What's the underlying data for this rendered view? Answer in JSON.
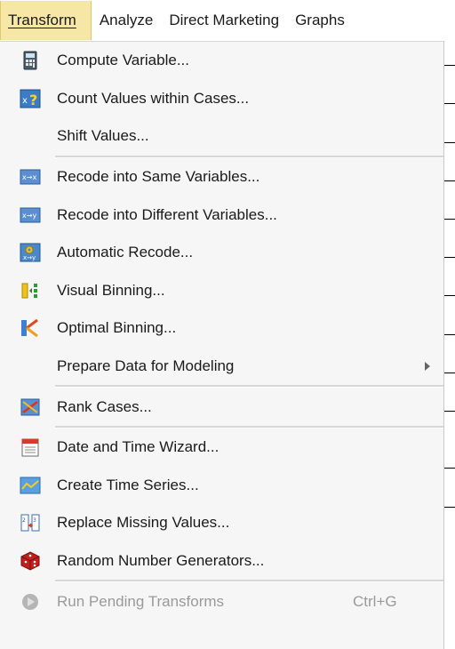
{
  "menubar": {
    "items": [
      {
        "label": "Transform",
        "active": true
      },
      {
        "label": "Analyze"
      },
      {
        "label": "Direct Marketing"
      },
      {
        "label": "Graphs"
      }
    ]
  },
  "menu": {
    "items": [
      {
        "label": "Compute Variable...",
        "icon": "calculator-icon"
      },
      {
        "label": "Count Values within Cases...",
        "icon": "count-x-question-icon"
      },
      {
        "label": "Shift Values...",
        "icon": null
      },
      {
        "label": "Recode into Same Variables...",
        "icon": "recode-same-icon"
      },
      {
        "label": "Recode into Different Variables...",
        "icon": "recode-different-icon"
      },
      {
        "label": "Automatic Recode...",
        "icon": "automatic-recode-icon"
      },
      {
        "label": "Visual Binning...",
        "icon": "visual-binning-icon"
      },
      {
        "label": "Optimal Binning...",
        "icon": "optimal-binning-icon"
      },
      {
        "label": "Prepare Data for Modeling",
        "icon": null,
        "submenu": true
      },
      {
        "label": "Rank Cases...",
        "icon": "rank-cases-icon"
      },
      {
        "label": "Date and Time Wizard...",
        "icon": "calendar-icon"
      },
      {
        "label": "Create Time Series...",
        "icon": "time-series-icon"
      },
      {
        "label": "Replace Missing Values...",
        "icon": "replace-missing-icon"
      },
      {
        "label": "Random Number Generators...",
        "icon": "dice-icon"
      },
      {
        "label": "Run Pending Transforms",
        "icon": "run-pending-icon",
        "disabled": true,
        "shortcut": "Ctrl+G"
      }
    ]
  },
  "colors": {
    "active_menu_bg": "#f6e7a6",
    "dropdown_bg": "#f6f6f6",
    "disabled_text": "#9a9a9a"
  }
}
